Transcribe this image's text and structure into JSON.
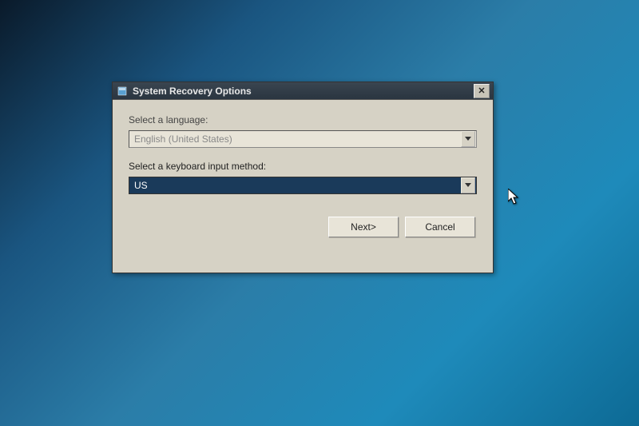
{
  "dialog": {
    "title": "System Recovery Options",
    "language_label": "Select a language:",
    "language_value": "English (United States)",
    "keyboard_label": "Select a keyboard input method:",
    "keyboard_value": "US",
    "next_button": "Next>",
    "cancel_button": "Cancel",
    "close_symbol": "✕"
  }
}
